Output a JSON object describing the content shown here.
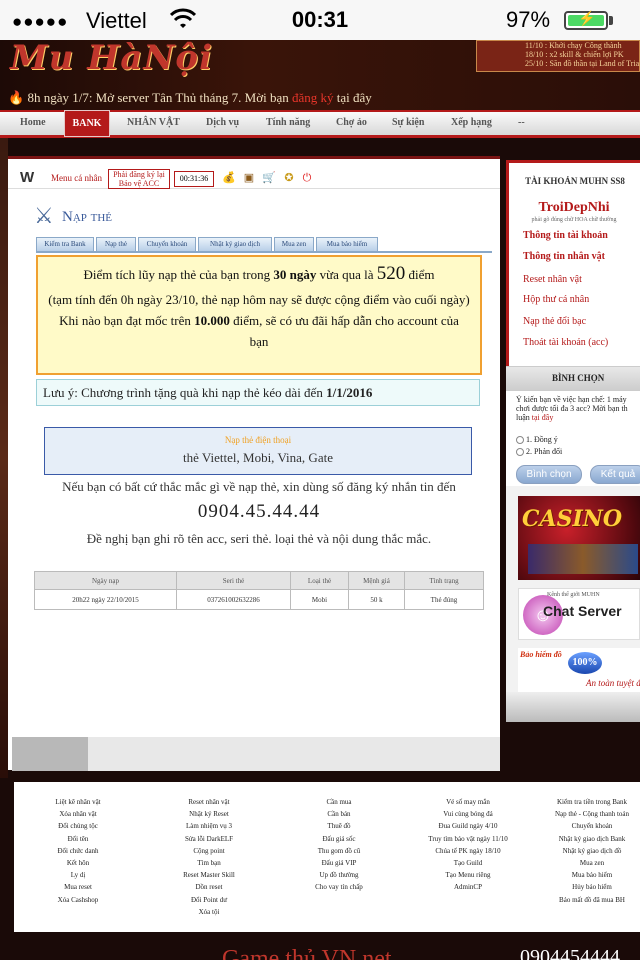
{
  "status_bar": {
    "signal": "●●●●●",
    "carrier": "Viettel",
    "time": "00:31",
    "battery": "97%",
    "battery_level": 0.97
  },
  "banner": {
    "logo": "Mu HàNội",
    "news": [
      "11/10 : Khởi chạy Công thành",
      "18/10 : x2 skill & chiến lợi PK",
      "25/10 : Săn đồ thần tại Land of Trials"
    ],
    "marquee_prefix": "8h ngày 1/7: Mở server Tân Thủ tháng 7. Mời bạn ",
    "marquee_link": "đăng ký",
    "marquee_suffix": " tại đây"
  },
  "nav": {
    "items": [
      "Home",
      "BANK",
      "NHÂN VẬT",
      "Dịch vụ",
      "Tính năng",
      "Chợ ảo",
      "Sự kiện",
      "Xếp hạng",
      "--"
    ],
    "active": "BANK"
  },
  "toolbar": {
    "logo": "W",
    "menu": "Menu cá nhân",
    "register_line1": "Phải đăng ký lại",
    "register_line2": "Bảo vệ ACC",
    "timer": "00:31:36"
  },
  "page": {
    "title": "Nạp thẻ",
    "tabs": [
      "Kiểm tra Bank",
      "Nạp thẻ",
      "Chuyển khoản",
      "Nhật ký giao dịch",
      "Mua zen",
      "Mua bảo hiểm"
    ],
    "notice": {
      "l1_a": "Điểm tích lũy nạp thẻ của bạn trong ",
      "l1_bold": "30 ngày",
      "l1_b": " vừa qua là ",
      "l1_big": "520",
      "l1_c": " điểm",
      "l2": "(tạm tính đến 0h ngày 23/10, thẻ nạp hôm nay sẽ được cộng điểm vào cuối ngày)",
      "l3_a": "Khi nào bạn đạt mốc trên ",
      "l3_bold": "10.000",
      "l3_b": " điểm, sẽ có ưu đãi hấp dẫn cho account của bạn"
    },
    "note_prefix": "Lưu ý: Chương trình tặng quà khi nạp thẻ kéo dài đến ",
    "note_date": "1/1/2016",
    "phone_box_title": "Nạp thẻ điện thoại",
    "phone_box_sub": "thẻ Viettel, Mobi, Vina, Gate",
    "help_line": "Nếu bạn có bất cứ thắc mắc gì về nạp thẻ, xin dùng số đăng ký nhắn tin đến",
    "help_number": "0904.45.44.44",
    "help_line2": "Đề nghị bạn ghi rõ tên acc, seri thẻ. loại thẻ và nội dung thắc mắc.",
    "table": {
      "headers": [
        "Ngày nạp",
        "Seri thẻ",
        "Loại thẻ",
        "Mệnh giá",
        "Tình trạng"
      ],
      "rows": [
        [
          "20h22 ngày 22/10/2015",
          "037261002632286",
          "Mobi",
          "50 k",
          "Thẻ đúng"
        ]
      ]
    }
  },
  "sidebar": {
    "account_header": "TÀI KHOẢN MUHN SS8",
    "username": "TroiDepNhi",
    "username_sub": "phải gõ đúng chữ HOA chữ thường",
    "links": [
      "Thông tin tài khoản",
      "Thông tin nhân vật",
      "Reset nhân vật",
      "Hộp thư cá nhân",
      "Nạp thẻ đổi bạc",
      "Thoát tài khoản (acc)"
    ],
    "vote_header": "BÌNH CHỌN",
    "vote_q1": "Ý kiến bạn về việc hạn chế: 1 máy",
    "vote_q2": "chơi được tối đa 3 acc? Mời bạn th",
    "vote_q3": "luận ",
    "vote_q3_link": "tại đây",
    "vote_opt1": "1. Đồng ý",
    "vote_opt2": "2. Phản đối",
    "vote_btn": "Bình chọn",
    "result_btn": "Kết quả",
    "casino": "CASINO",
    "chat_small": "Kênh thế giới MUHN",
    "chat_big": "Chat Server",
    "insurance_title": "Bảo hiểm đồ",
    "insurance_badge": "100%",
    "insurance_sub": "An toàn tuyệt đối"
  },
  "footer": {
    "col1": [
      "Liệt kê nhân vật",
      "Xóa nhân vật",
      "Đổi chủng tộc",
      "Đổi tên",
      "Đổi chức danh",
      "Kết hôn",
      "Ly dị",
      "Mua reset",
      "Xóa Cashshop"
    ],
    "col2": [
      "Reset nhân vật",
      "Nhật ký Reset",
      "Làm nhiệm vụ 3",
      "Sửa lỗi DarkELF",
      "Cộng point",
      "Tìm bạn",
      "Reset Master Skill",
      "Dồn reset",
      "Đổi Point dư",
      "Xóa tội"
    ],
    "col3": [
      "Cần mua",
      "Cần bán",
      "Thuê đồ",
      "Đấu giá sốc",
      "Thu gom đồ cũ",
      "Đấu giá VIP",
      "Up đồ thường",
      "Cho vay tín chấp"
    ],
    "col4": [
      "Vé số may mắn",
      "Vui cùng bóng đá",
      "Đua Guild ngày 4/10",
      "Truy tìm bảo vật ngày 11/10",
      "Chúa tể PK ngày 18/10",
      "Tạo Guild",
      "Tạo Menu riêng",
      "AdminCP"
    ],
    "col5": [
      "Kiểm tra tiền trong Bank",
      "Nạp thẻ - Cộng thanh toán",
      "Chuyển khoản",
      "Nhật ký giao dịch Bank",
      "Nhật ký giao dịch đồ",
      "Mua zen",
      "Mua bảo hiểm",
      "Hủy bảo hiểm",
      "Bảo mất đồ đã mua BH"
    ],
    "bottom_left": "Game thủ VN.net",
    "bottom_right": "0904454444"
  }
}
